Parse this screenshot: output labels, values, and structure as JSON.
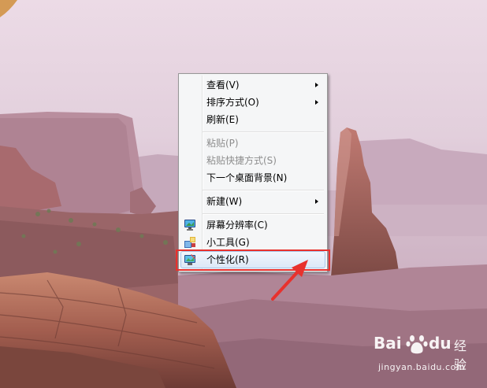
{
  "context_menu": {
    "items": [
      {
        "label": "查看(V)",
        "submenu": true,
        "enabled": true
      },
      {
        "label": "排序方式(O)",
        "submenu": true,
        "enabled": true
      },
      {
        "label": "刷新(E)",
        "submenu": false,
        "enabled": true
      },
      {
        "label": "粘贴(P)",
        "submenu": false,
        "enabled": false
      },
      {
        "label": "粘贴快捷方式(S)",
        "submenu": false,
        "enabled": false
      },
      {
        "label": "下一个桌面背景(N)",
        "submenu": false,
        "enabled": true
      },
      {
        "label": "新建(W)",
        "submenu": true,
        "enabled": true
      },
      {
        "label": "屏幕分辨率(C)",
        "submenu": false,
        "enabled": true,
        "icon": "monitor-icon"
      },
      {
        "label": "小工具(G)",
        "submenu": false,
        "enabled": true,
        "icon": "gadgets-icon"
      },
      {
        "label": "个性化(R)",
        "submenu": false,
        "enabled": true,
        "icon": "personalize-icon",
        "hovered": true
      }
    ]
  },
  "annotation": {
    "color": "#e8312d"
  },
  "watermark": {
    "brand_bai": "Bai",
    "brand_du": "du",
    "brand_jingyan": "经验",
    "url": "jingyan.baidu.com"
  }
}
